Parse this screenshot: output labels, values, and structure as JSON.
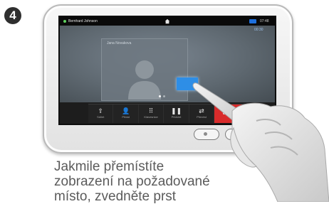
{
  "step": {
    "number": "4"
  },
  "status_bar": {
    "user_name": "Bernhard Johnson",
    "clock": "07:48",
    "call_duration": "00:30"
  },
  "call": {
    "remote_label": "Jana Novakova"
  },
  "toolbar": {
    "buttons": [
      {
        "label": "Sdílet",
        "icon": "share-icon"
      },
      {
        "label": "Přidat",
        "icon": "add-participant-icon"
      },
      {
        "label": "Klávesnice",
        "icon": "keypad-icon"
      },
      {
        "label": "Přidržet",
        "icon": "hold-icon"
      },
      {
        "label": "Přenést",
        "icon": "transfer-icon"
      }
    ],
    "end_call_label": "Ukončit"
  },
  "caption": {
    "lines": [
      "Jakmile přemístíte",
      "zobrazení na požadované",
      "místo, zvedněte prst"
    ]
  },
  "colors": {
    "end_call": "#d82b2b",
    "highlight": "#2e8ee6"
  }
}
